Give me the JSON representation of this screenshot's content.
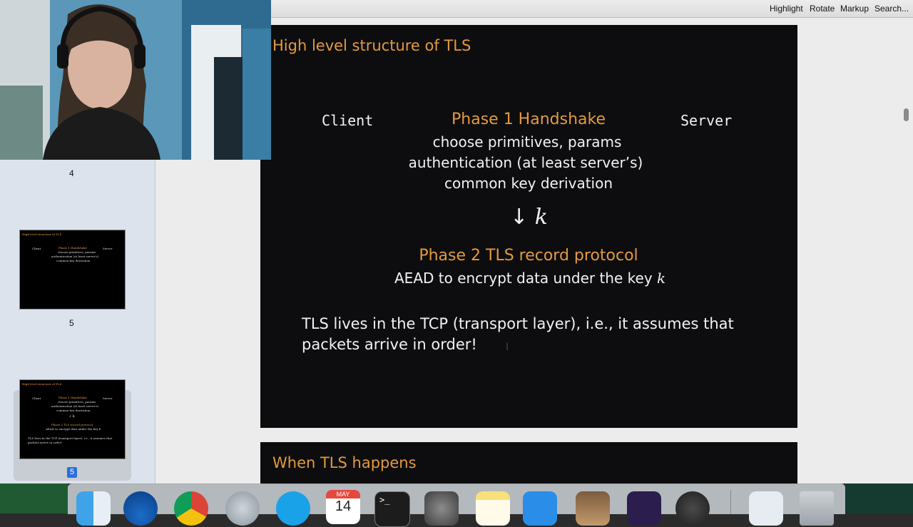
{
  "toolbar": {
    "title_fragment": "",
    "buttons": [
      "Highlight",
      "Rotate",
      "Markup",
      "Search..."
    ]
  },
  "sidebar": {
    "page_numbers": [
      "4",
      "5"
    ],
    "selected_badge": "5",
    "thumb": {
      "title": "High level structure of TLS",
      "client": "Client",
      "phase1": "Phase 1 Handshake",
      "server": "Server",
      "line1": "choose primitives, params",
      "line2": "authentication (at least server's)",
      "line3": "common key derivation",
      "arrow": "↓ k",
      "phase2": "Phase 2 TLS record protocol",
      "aead": "AEAD to encrypt data under the key k",
      "tcp1": "TLS lives in the TCP (transport layer), i.e., it assumes that",
      "tcp2": "packets arrive in order!"
    }
  },
  "slide1": {
    "title": "High level structure of TLS",
    "client": "Client",
    "server": "Server",
    "phase1": "Phase 1 Handshake",
    "phase1_lines": [
      "choose primitives, params",
      "authentication (at least server’s)",
      "common key derivation"
    ],
    "arrow": "↓",
    "key": "k",
    "phase2": "Phase 2 TLS record protocol",
    "aead": "AEAD to encrypt data under the key",
    "tcp_lines": [
      "TLS lives in the TCP (transport layer), i.e., it assumes that",
      "packets arrive in order!"
    ]
  },
  "slide2": {
    "title": "When TLS happens"
  },
  "dock": {
    "calendar_month": "MAY",
    "calendar_day": "14",
    "terminal_prompt": ">_",
    "icons": [
      "finder-icon",
      "thunderbird-icon",
      "chrome-icon",
      "launchpad-icon",
      "skype-icon",
      "calendar-icon",
      "terminal-icon",
      "system-preferences-icon",
      "notes-icon",
      "xcode-icon",
      "preview-icon",
      "app-icon",
      "quicktime-icon",
      "downloads-icon",
      "trash-icon"
    ]
  }
}
